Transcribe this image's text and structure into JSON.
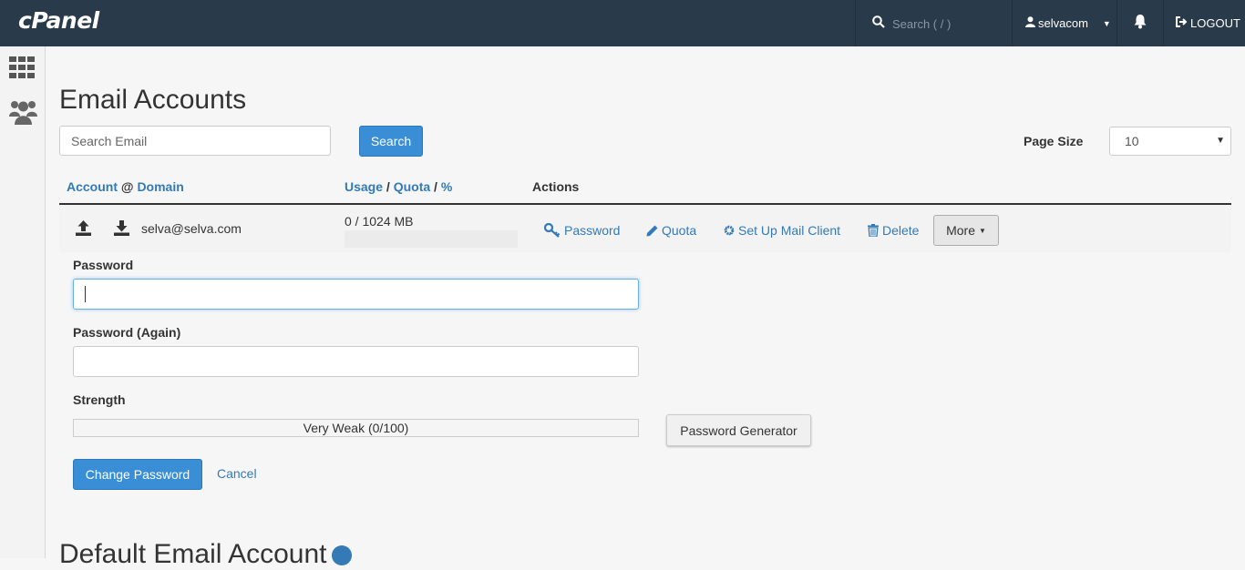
{
  "topbar": {
    "logo": "cPanel",
    "search_placeholder": "Search ( / )",
    "username": "selvacom",
    "logout_label": "LOGOUT"
  },
  "main": {
    "title": "Email Accounts",
    "search_placeholder": "Search Email",
    "search_button": "Search",
    "page_size_label": "Page Size",
    "page_size_value": "10",
    "columns": {
      "account": "Account",
      "at": "@",
      "domain": "Domain",
      "usage": "Usage",
      "quota": "Quota",
      "percent": "%",
      "slash": "/",
      "actions": "Actions"
    },
    "row": {
      "email": "selva@selva.com",
      "usage": "0 / 1024 MB",
      "usage_fraction": 0,
      "actions": {
        "password": "Password",
        "quota": "Quota",
        "setup": "Set Up Mail Client",
        "delete": "Delete",
        "more": "More"
      }
    },
    "form": {
      "password_label": "Password",
      "password_again_label": "Password (Again)",
      "strength_label": "Strength",
      "strength_text": "Very Weak (0/100)",
      "generator_button": "Password Generator",
      "change_button": "Change Password",
      "cancel_link": "Cancel"
    },
    "next_section_title": "Default Email Account"
  },
  "colors": {
    "topbar": "#293a4a",
    "link": "#337ab7",
    "primary_button": "#3a8ed6"
  }
}
